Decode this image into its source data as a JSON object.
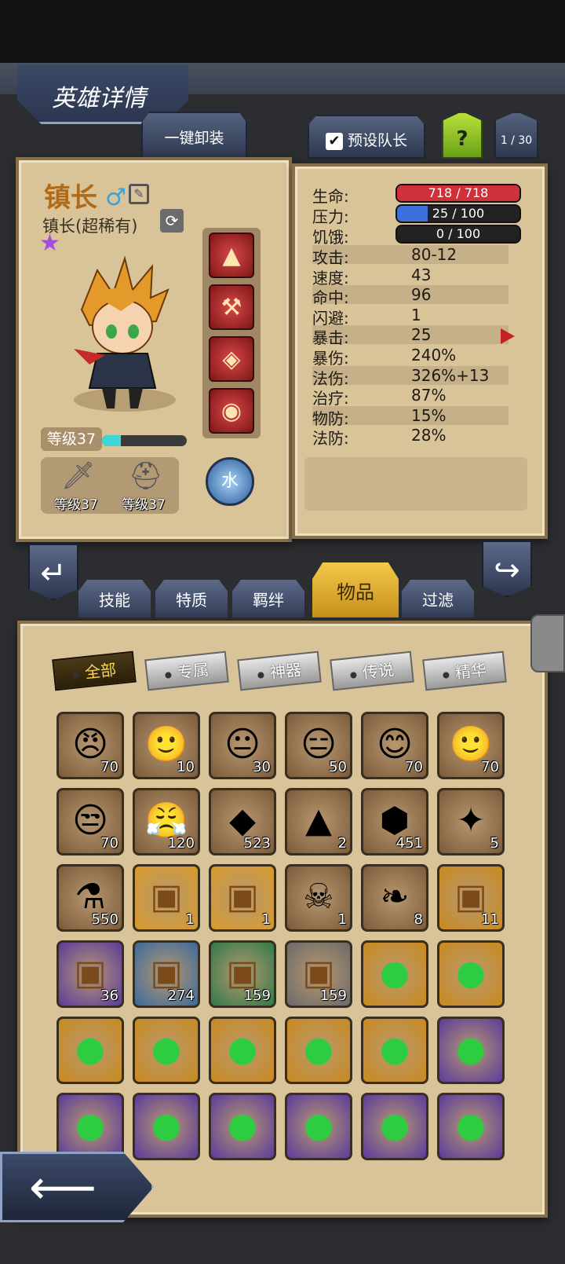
{
  "header": {
    "title": "英雄详情"
  },
  "actions": {
    "unequip_label": "一键卸装",
    "preset_captain_label": "预设队长",
    "preset_captain_checked": "✔",
    "help_label": "?",
    "roster_count": "1 / 30"
  },
  "hero": {
    "name": "镇长",
    "gender_icon": "male-icon",
    "class": "镇长(超稀有)",
    "rarity_icon": "purple-star-icon",
    "level_label": "等级37",
    "exp_progress": 0.22,
    "weapon_level": "等级37",
    "armor_level": "等级37",
    "element": "水",
    "equipment": [
      "wizard-hat-icon",
      "golden-axe-icon",
      "ruby-bracer-icon",
      "ruby-amulet-icon"
    ]
  },
  "stats": {
    "hp_label": "生命:",
    "hp_value": "718 / 718",
    "hp_fraction": 1.0,
    "stress_label": "压力:",
    "stress_value": "25 / 100",
    "stress_fraction": 0.25,
    "hunger_label": "饥饿:",
    "hunger_value": "0 / 100",
    "hunger_fraction": 0.0,
    "rows": [
      {
        "label": "攻击:",
        "value": "80-12"
      },
      {
        "label": "速度:",
        "value": "43"
      },
      {
        "label": "命中:",
        "value": "96"
      },
      {
        "label": "闪避:",
        "value": "1"
      },
      {
        "label": "暴击:",
        "value": "25"
      },
      {
        "label": "暴伤:",
        "value": "240%"
      },
      {
        "label": "法伤:",
        "value": "326%+13"
      },
      {
        "label": "治疗:",
        "value": "87%"
      },
      {
        "label": "物防:",
        "value": "15%"
      },
      {
        "label": "法防:",
        "value": "28%"
      }
    ],
    "colors": {
      "hp": "#d0303a",
      "stress": "#3c6fd8",
      "hunger": "#444444"
    }
  },
  "tabs": [
    {
      "label": "技能"
    },
    {
      "label": "特质"
    },
    {
      "label": "羁绊"
    },
    {
      "label": "物品",
      "active": true
    },
    {
      "label": "过滤"
    }
  ],
  "filters": [
    {
      "label": "全部",
      "active": true
    },
    {
      "label": "专属"
    },
    {
      "label": "神器"
    },
    {
      "label": "传说"
    },
    {
      "label": "精华"
    }
  ],
  "inventory": [
    {
      "icon": "hero-portrait-icon",
      "count": "70",
      "bg": "#7a5a3a",
      "glyph": "😠"
    },
    {
      "icon": "hero-portrait-icon",
      "count": "10",
      "bg": "#7a5a3a",
      "glyph": "🙂"
    },
    {
      "icon": "hero-portrait-icon",
      "count": "30",
      "bg": "#7a5a3a",
      "glyph": "😐"
    },
    {
      "icon": "hero-portrait-icon",
      "count": "50",
      "bg": "#7a5a3a",
      "glyph": "😑"
    },
    {
      "icon": "hero-portrait-icon",
      "count": "70",
      "bg": "#7a5a3a",
      "glyph": "😊"
    },
    {
      "icon": "hero-portrait-icon",
      "count": "70",
      "bg": "#7a5a3a",
      "glyph": "🙂"
    },
    {
      "icon": "hero-portrait-icon",
      "count": "70",
      "bg": "#7a5a3a",
      "glyph": "😒"
    },
    {
      "icon": "hero-portrait-icon",
      "count": "120",
      "bg": "#7a5a3a",
      "glyph": "😤"
    },
    {
      "icon": "amber-gem-icon",
      "count": "523",
      "bg": "#7a5a3a",
      "glyph": "◆"
    },
    {
      "icon": "crystal-pile-icon",
      "count": "2",
      "bg": "#7a5a3a",
      "glyph": "▲"
    },
    {
      "icon": "teal-rune-icon",
      "count": "451",
      "bg": "#7a5a3a",
      "glyph": "⬢"
    },
    {
      "icon": "golden-horn-icon",
      "count": "5",
      "bg": "#7a5a3a",
      "glyph": "✦"
    },
    {
      "icon": "potion-flask-icon",
      "count": "550",
      "bg": "#7a5a3a",
      "glyph": "⚗"
    },
    {
      "icon": "treasure-chest-icon",
      "count": "1",
      "bg": "#d89a2a",
      "glyph": "▣"
    },
    {
      "icon": "treasure-chest-icon",
      "count": "1",
      "bg": "#d89a2a",
      "glyph": "▣"
    },
    {
      "icon": "skull-scroll-icon",
      "count": "1",
      "bg": "#7a5a3a",
      "glyph": "☠"
    },
    {
      "icon": "white-feather-icon",
      "count": "8",
      "bg": "#7a5a3a",
      "glyph": "❧"
    },
    {
      "icon": "treasure-chest-icon",
      "count": "11",
      "bg": "#c98a1e",
      "glyph": "▣"
    },
    {
      "icon": "treasure-chest-icon",
      "count": "36",
      "bg": "#5b3b9c",
      "glyph": "▣"
    },
    {
      "icon": "treasure-chest-icon",
      "count": "274",
      "bg": "#3a6a9c",
      "glyph": "▣"
    },
    {
      "icon": "treasure-chest-icon",
      "count": "159",
      "bg": "#2f7a4a",
      "glyph": "▣"
    },
    {
      "icon": "treasure-chest-icon",
      "count": "159",
      "bg": "#6a6a6a",
      "glyph": "▣"
    },
    {
      "icon": "green-orb-icon",
      "count": "",
      "bg": "#c98a1e",
      "glyph": "●"
    },
    {
      "icon": "green-orb-icon",
      "count": "",
      "bg": "#c98a1e",
      "glyph": "●"
    },
    {
      "icon": "green-orb-icon",
      "count": "",
      "bg": "#c98a1e",
      "glyph": "●"
    },
    {
      "icon": "green-orb-icon",
      "count": "",
      "bg": "#c98a1e",
      "glyph": "●"
    },
    {
      "icon": "green-orb-icon",
      "count": "",
      "bg": "#c98a1e",
      "glyph": "●"
    },
    {
      "icon": "green-orb-icon",
      "count": "",
      "bg": "#c98a1e",
      "glyph": "●"
    },
    {
      "icon": "green-orb-icon",
      "count": "",
      "bg": "#c98a1e",
      "glyph": "●"
    },
    {
      "icon": "green-orb-icon",
      "count": "",
      "bg": "#5b3b9c",
      "glyph": "●"
    },
    {
      "icon": "green-orb-icon",
      "count": "",
      "bg": "#5b3b9c",
      "glyph": "●"
    },
    {
      "icon": "green-orb-icon",
      "count": "",
      "bg": "#5b3b9c",
      "glyph": "●"
    },
    {
      "icon": "green-orb-icon",
      "count": "",
      "bg": "#5b3b9c",
      "glyph": "●"
    },
    {
      "icon": "green-orb-icon",
      "count": "",
      "bg": "#5b3b9c",
      "glyph": "●"
    },
    {
      "icon": "green-orb-icon",
      "count": "",
      "bg": "#5b3b9c",
      "glyph": "●"
    },
    {
      "icon": "green-orb-icon",
      "count": "",
      "bg": "#5b3b9c",
      "glyph": "●"
    }
  ],
  "navigation": {
    "back_icon": "back-arrow-icon",
    "prev_icon": "prev-hero-icon",
    "next_icon": "next-hero-icon"
  }
}
